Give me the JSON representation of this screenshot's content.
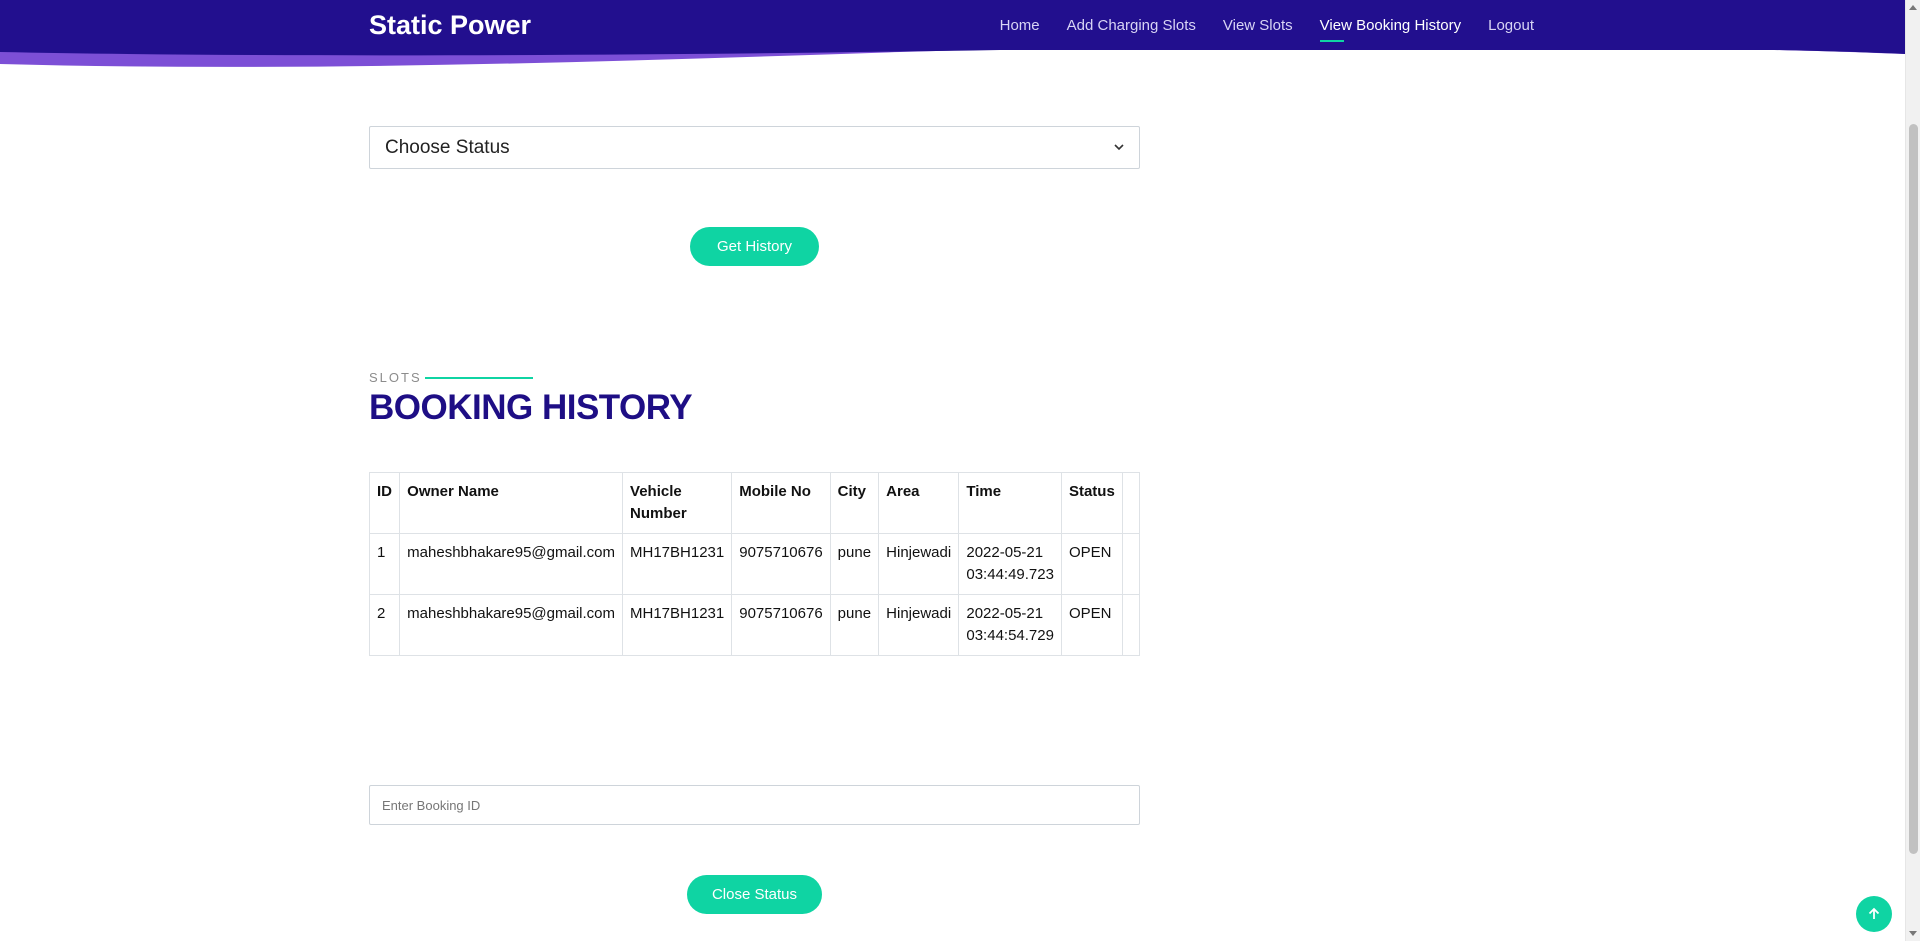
{
  "brand": "Static Power",
  "nav": {
    "items": [
      "Home",
      "Add Charging Slots",
      "View Slots",
      "View Booking History",
      "Logout"
    ],
    "active": "View Booking History"
  },
  "filter": {
    "select_value": "Choose Status",
    "button_label": "Get History"
  },
  "section": {
    "kicker": "SLOTS",
    "title": "BOOKING HISTORY"
  },
  "table": {
    "headers": [
      "ID",
      "Owner Name",
      "Vehicle Number",
      "Mobile No",
      "City",
      "Area",
      "Time",
      "Status"
    ],
    "rows": [
      [
        "1",
        "maheshbhakare95@gmail.com",
        "MH17BH1231",
        "9075710676",
        "pune",
        "Hinjewadi",
        "2022-05-21 03:44:49.723",
        "OPEN"
      ],
      [
        "2",
        "maheshbhakare95@gmail.com",
        "MH17BH1231",
        "9075710676",
        "pune",
        "Hinjewadi",
        "2022-05-21 03:44:54.729",
        "OPEN"
      ]
    ]
  },
  "close_form": {
    "input_placeholder": "Enter Booking ID",
    "button_label": "Close Status"
  },
  "colors": {
    "header_bg": "#1e0e85",
    "accent": "#0fd4a3",
    "title": "#1e0e85"
  },
  "icons": {
    "select_chevron": "chevron-down-icon",
    "scroll_top": "arrow-up-icon"
  }
}
